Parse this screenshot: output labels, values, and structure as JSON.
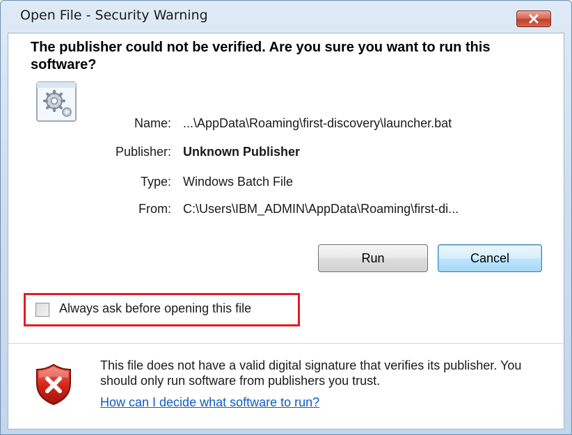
{
  "window": {
    "title": "Open File - Security Warning"
  },
  "headline": "The publisher could not be verified.  Are you sure you want to run this software?",
  "file_info": {
    "name_label": "Name:",
    "name_value": "...\\AppData\\Roaming\\first-discovery\\launcher.bat",
    "publisher_label": "Publisher:",
    "publisher_value": "Unknown Publisher",
    "type_label": "Type:",
    "type_value": "Windows Batch File",
    "from_label": "From:",
    "from_value": "C:\\Users\\IBM_ADMIN\\AppData\\Roaming\\first-di..."
  },
  "buttons": {
    "run_label": "Run",
    "cancel_label": "Cancel"
  },
  "checkbox": {
    "label": "Always ask before opening this file",
    "checked": false
  },
  "warning": {
    "text": "This file does not have a valid digital signature that verifies its publisher.  You should only run software from publishers you trust.",
    "link_text": "How can I decide what software to run?"
  },
  "icons": {
    "app": "batch-file-gear-icon",
    "warning": "red-shield-x-icon",
    "close": "close-icon"
  },
  "colors": {
    "highlight": "#e31b23",
    "link": "#0b5bc9",
    "close_button": "#c2402a"
  }
}
